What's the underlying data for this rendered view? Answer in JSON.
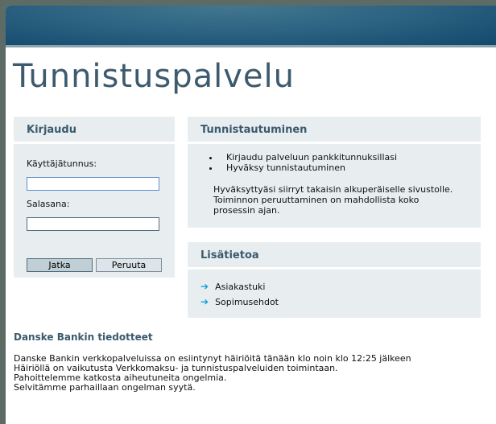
{
  "page_title": "Tunnistuspalvelu",
  "login": {
    "heading": "Kirjaudu",
    "username_label": "Käyttäjätunnus:",
    "username_value": "",
    "password_label": "Salasana:",
    "password_value": "",
    "continue_label": "Jatka",
    "cancel_label": "Peruuta"
  },
  "auth": {
    "heading": "Tunnistautuminen",
    "steps": [
      "Kirjaudu palveluun pankkitunnuksillasi",
      "Hyväksy tunnistautuminen"
    ],
    "note_lines": [
      "Hyväksyttyäsi siirryt takaisin alkuperäiselle sivustolle.",
      "Toiminnon peruuttaminen on mahdollista koko",
      "prosessin ajan."
    ]
  },
  "info": {
    "heading": "Lisätietoa",
    "links": [
      "Asiakastuki",
      "Sopimusehdot"
    ]
  },
  "news": {
    "heading": "Danske Bankin tiedotteet",
    "lines": [
      "Danske Bankin verkkopalveluissa on esiintynyt häiriöitä tänään klo noin klo 12:25 jälkeen",
      "Häiriöllä on vaikutusta Verkkomaksu- ja tunnistuspalveluiden toimintaan.",
      "Pahoittelemme katkosta aiheutuneita ongelmia.",
      "Selvitämme parhaillaan ongelman syytä."
    ]
  }
}
